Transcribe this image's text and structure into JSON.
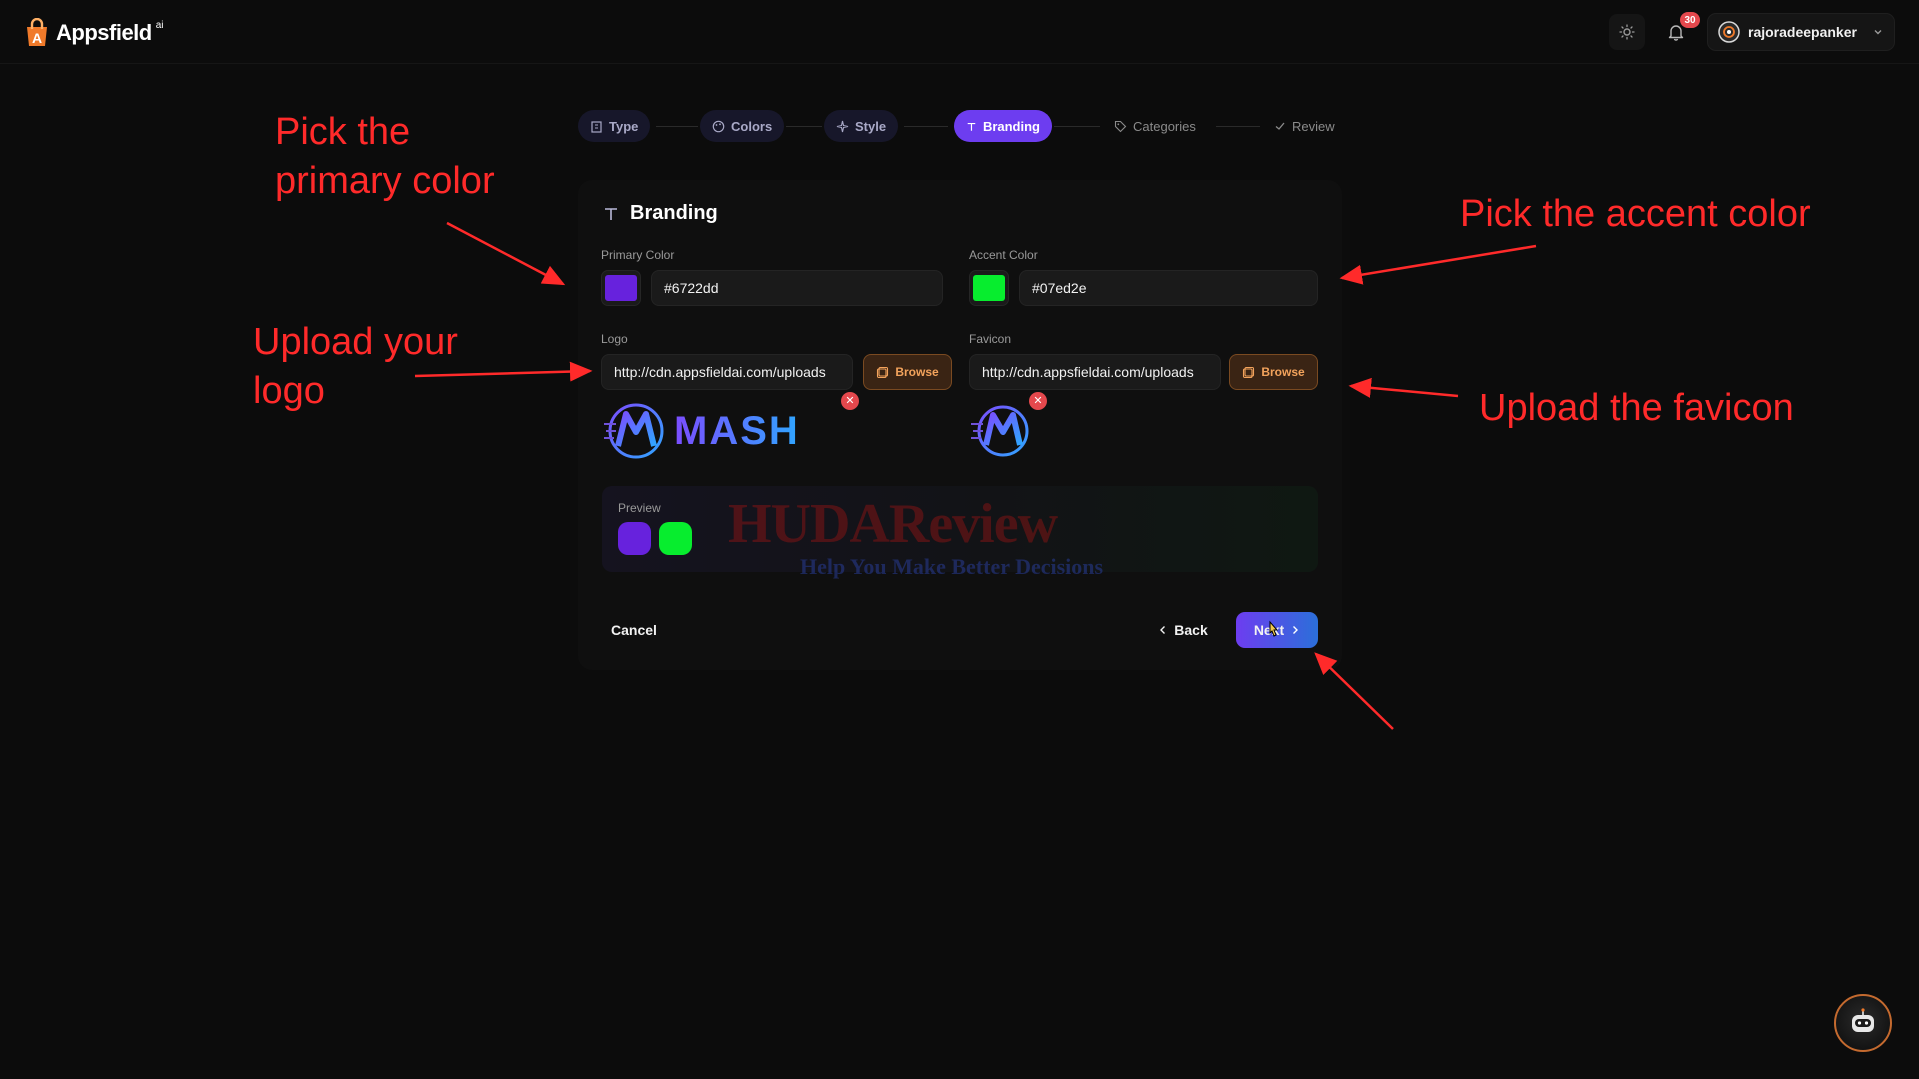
{
  "header": {
    "brand": "Appsfield",
    "brand_sup": "ai",
    "notifications_count": "30",
    "username": "rajoradeepanker"
  },
  "stepper": {
    "steps": [
      {
        "label": "Type",
        "icon": "building-icon",
        "state": "done"
      },
      {
        "label": "Colors",
        "icon": "palette-icon",
        "state": "done"
      },
      {
        "label": "Style",
        "icon": "sparkles-icon",
        "state": "done"
      },
      {
        "label": "Branding",
        "icon": "type-icon",
        "state": "active"
      },
      {
        "label": "Categories",
        "icon": "tag-icon",
        "state": "todo"
      },
      {
        "label": "Review",
        "icon": "check-icon",
        "state": "todo"
      }
    ]
  },
  "form": {
    "title": "Branding",
    "primary_label": "Primary Color",
    "primary_value": "#6722dd",
    "accent_label": "Accent Color",
    "accent_value": "#07ed2e",
    "logo_label": "Logo",
    "logo_value": "http://cdn.appsfieldai.com/uploads",
    "favicon_label": "Favicon",
    "favicon_value": "http://cdn.appsfieldai.com/uploads",
    "browse_label": "Browse",
    "logo_preview_text": "MASH",
    "preview_label": "Preview",
    "cancel_label": "Cancel",
    "back_label": "Back",
    "next_label": "Next"
  },
  "watermark": {
    "title": "HUDAReview",
    "tagline": "Help You Make Better Decisions"
  },
  "annotations": {
    "primary": [
      "Pick the",
      "primary color"
    ],
    "logo": [
      "Upload your",
      "logo"
    ],
    "accent": "Pick the accent color",
    "favicon": "Upload the favicon"
  },
  "colors": {
    "primary": "#6722dd",
    "accent": "#07ed2e",
    "annotation": "#ff2a2a",
    "browse": "#f3a35c"
  }
}
